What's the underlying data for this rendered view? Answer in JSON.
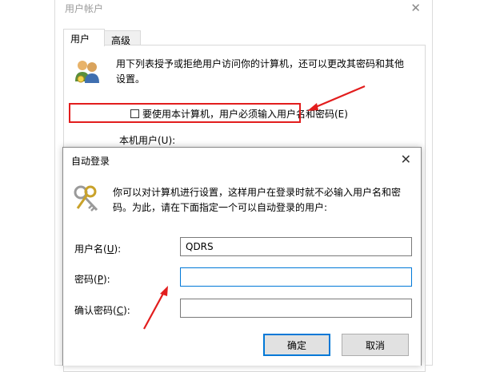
{
  "user_accounts": {
    "title": "用户帐户",
    "tabs": [
      "用户",
      "高级"
    ],
    "description": "用下列表授予或拒绝用户访问你的计算机，还可以更改其密码和其他设置。",
    "checkbox_label": "要使用本计算机，用户必须输入用户名和密码(E)",
    "checkbox_checked": false,
    "users_label": "本机用户(U):"
  },
  "auto_logon": {
    "title": "自动登录",
    "description": "你可以对计算机进行设置，这样用户在登录时就不必输入用户名和密码。为此，请在下面指定一个可以自动登录的用户:",
    "fields": [
      {
        "label_pre": "用户名(",
        "key": "U",
        "label_post": "):",
        "value": "QDRS"
      },
      {
        "label_pre": "密码(",
        "key": "P",
        "label_post": "):",
        "value": ""
      },
      {
        "label_pre": "确认密码(",
        "key": "C",
        "label_post": "):",
        "value": ""
      }
    ],
    "ok_label": "确定",
    "cancel_label": "取消"
  },
  "accent_color": "#0078d7",
  "annotation_color": "#e21d1d",
  "icons": [
    "users-icon",
    "keys-icon",
    "close-icon",
    "red-arrow"
  ]
}
